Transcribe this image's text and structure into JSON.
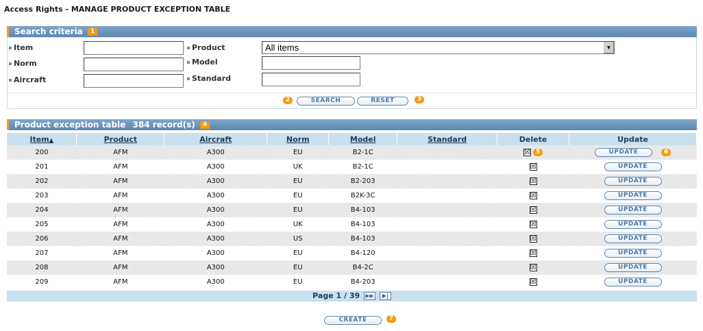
{
  "page_title": "Access Rights - MANAGE PRODUCT EXCEPTION TABLE",
  "search": {
    "header": "Search criteria",
    "header_marker": "1",
    "labels": {
      "item": "Item",
      "norm": "Norm",
      "aircraft": "Aircraft",
      "product": "Product",
      "model": "Model",
      "standard": "Standard"
    },
    "values": {
      "item": "",
      "norm": "",
      "aircraft": "",
      "model": "",
      "standard": "",
      "product": "All items"
    },
    "search_label": "SEARCH",
    "reset_label": "RESET",
    "search_marker": "2",
    "reset_marker": "3"
  },
  "table": {
    "header": "Product exception table",
    "record_count": "384 record(s)",
    "header_marker": "4",
    "columns": [
      "Item",
      "Product",
      "Aircraft",
      "Norm",
      "Model",
      "Standard",
      "Delete",
      "Update"
    ],
    "sort_icon": "sort-ascending-icon",
    "update_label": "UPDATE",
    "delete_marker": "5",
    "update_marker": "6",
    "rows": [
      {
        "item": "200",
        "product": "AFM",
        "aircraft": "A300",
        "norm": "EU",
        "model": "B2-1C",
        "standard": "",
        "delete": "☒"
      },
      {
        "item": "201",
        "product": "AFM",
        "aircraft": "A300",
        "norm": "UK",
        "model": "B2-1C",
        "standard": "",
        "delete": "☒"
      },
      {
        "item": "202",
        "product": "AFM",
        "aircraft": "A300",
        "norm": "EU",
        "model": "B2-203",
        "standard": "",
        "delete": "☒"
      },
      {
        "item": "203",
        "product": "AFM",
        "aircraft": "A300",
        "norm": "EU",
        "model": "B2K-3C",
        "standard": "",
        "delete": "☒"
      },
      {
        "item": "204",
        "product": "AFM",
        "aircraft": "A300",
        "norm": "EU",
        "model": "B4-103",
        "standard": "",
        "delete": "☒"
      },
      {
        "item": "205",
        "product": "AFM",
        "aircraft": "A300",
        "norm": "UK",
        "model": "B4-103",
        "standard": "",
        "delete": "☒"
      },
      {
        "item": "206",
        "product": "AFM",
        "aircraft": "A300",
        "norm": "US",
        "model": "B4-103",
        "standard": "",
        "delete": "☒"
      },
      {
        "item": "207",
        "product": "AFM",
        "aircraft": "A300",
        "norm": "EU",
        "model": "B4-120",
        "standard": "",
        "delete": "☒"
      },
      {
        "item": "208",
        "product": "AFM",
        "aircraft": "A300",
        "norm": "EU",
        "model": "B4-2C",
        "standard": "",
        "delete": "☒"
      },
      {
        "item": "209",
        "product": "AFM",
        "aircraft": "A300",
        "norm": "EU",
        "model": "B4-203",
        "standard": "",
        "delete": "☒"
      }
    ],
    "pagination": {
      "text": "Page 1 / 39",
      "next_icon": "next-page-icon",
      "last_icon": "last-page-icon"
    }
  },
  "create_label": "CREATE",
  "create_marker": "7",
  "colors": {
    "header_blue": "#5d88b2",
    "accent_orange": "#f39c12",
    "grid_header": "#c9e0ef",
    "button_text": "#4a78a4"
  }
}
